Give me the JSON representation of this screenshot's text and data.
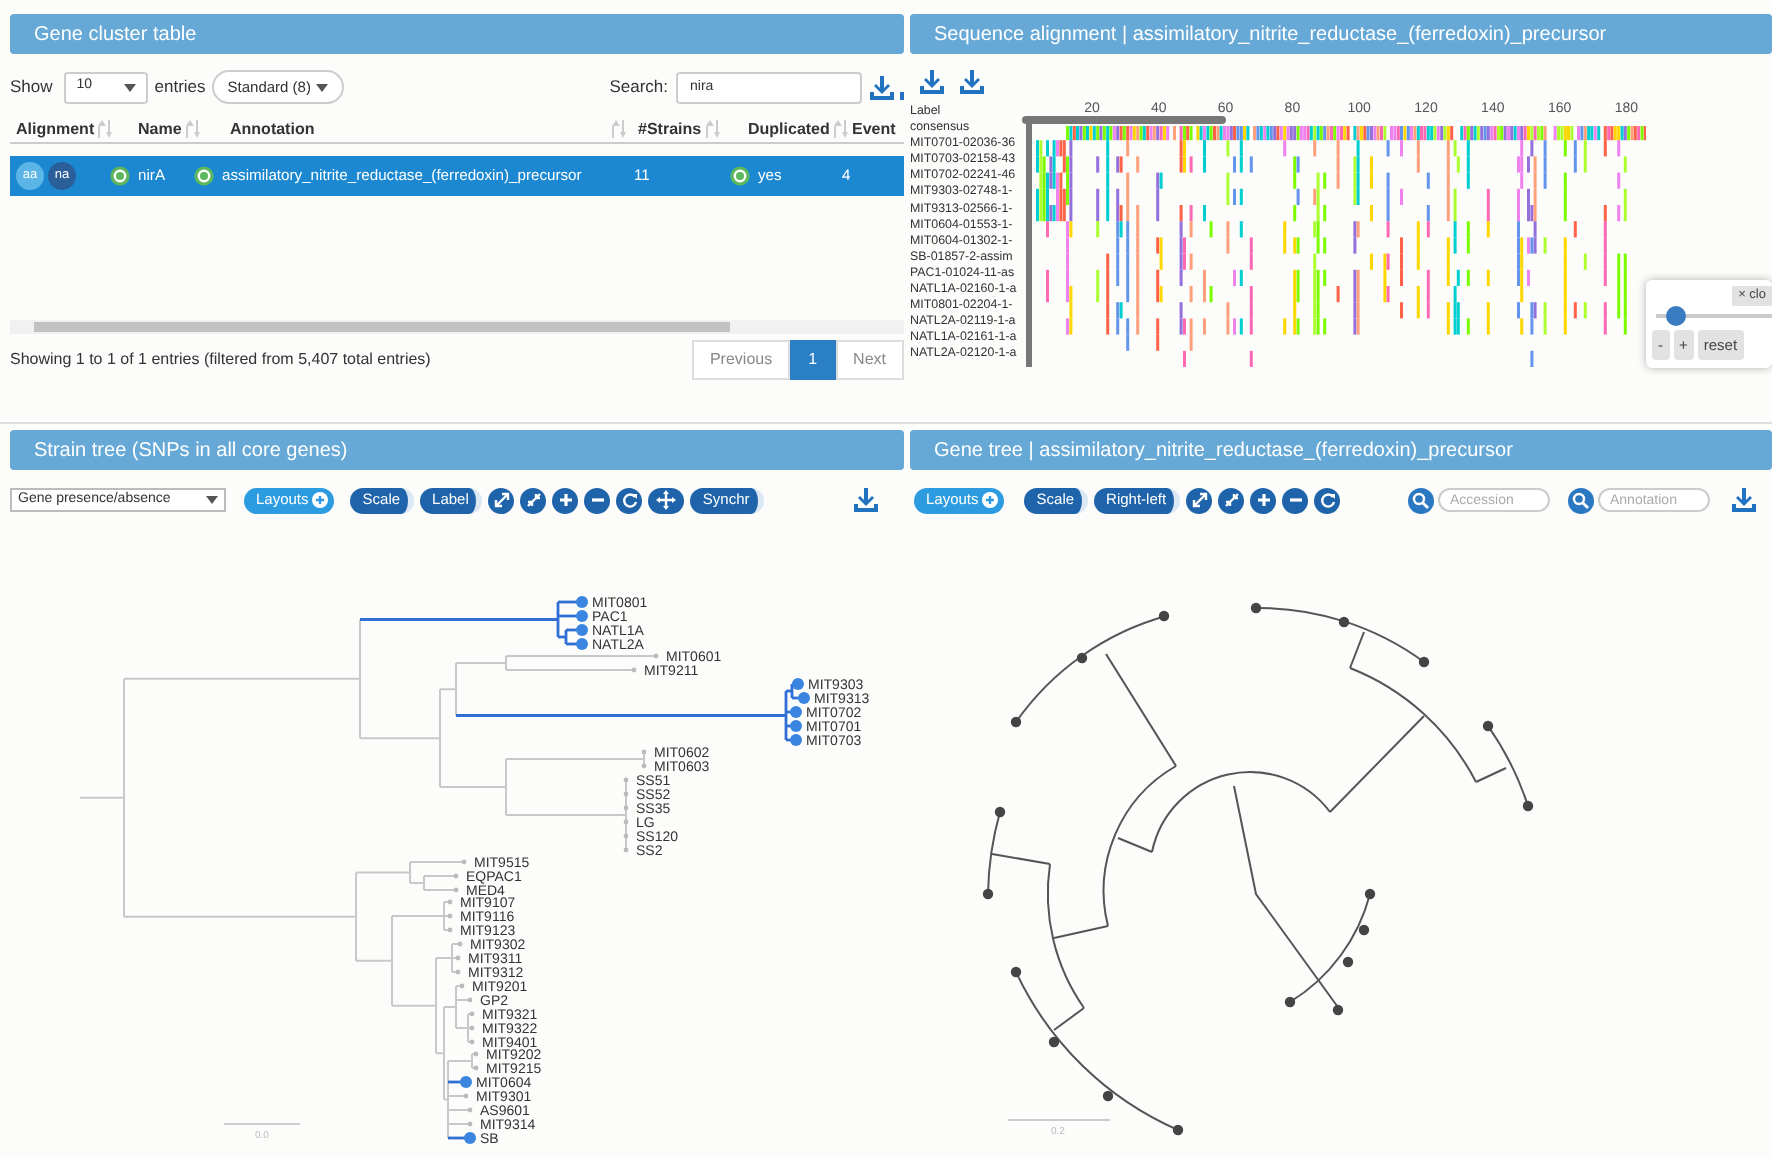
{
  "gene_cluster_table": {
    "title": "Gene cluster table",
    "show_label": "Show",
    "page_size": "10",
    "entries_label": "entries",
    "column_set": "Standard (8)",
    "search_label": "Search:",
    "search_value": "nira",
    "columns": [
      "Alignment",
      "Name",
      "Annotation",
      "#Strains",
      "Duplicated",
      "Event"
    ],
    "rows": [
      {
        "selected": true,
        "alignment_buttons": [
          "aa",
          "na"
        ],
        "name": "nirA",
        "annotation": "assimilatory_nitrite_reductase_(ferredoxin)_precursor",
        "strains": "11",
        "duplicated": "yes",
        "events": "4"
      }
    ],
    "info": "Showing 1 to 1 of 1 entries (filtered from 5,407 total entries)",
    "pagination": [
      {
        "label": "Previous",
        "selected": false
      },
      {
        "label": "1",
        "selected": true
      },
      {
        "label": "Next",
        "selected": false
      }
    ]
  },
  "sequence_alignment": {
    "title": "Sequence alignment | assimilatory_nitrite_reductase_(ferredoxin)_precursor",
    "ruler_ticks": [
      "20",
      "40",
      "60",
      "80",
      "100",
      "120",
      "140",
      "160",
      "180"
    ],
    "label_header": "Label",
    "rows": [
      "consensus",
      "MIT0701-02036-36",
      "MIT0703-02158-43",
      "MIT0702-02241-46",
      "MIT9303-02748-1-",
      "MIT9313-02566-1-",
      "MIT0604-01553-1-",
      "MIT0604-01302-1-",
      "SB-01857-2-assim",
      "PAC1-01024-11-as",
      "NATL1A-02160-1-a",
      "MIT0801-02204-1-",
      "NATL2A-02119-1-a",
      "NATL1A-02161-1-a",
      "NATL2A-02120-1-a"
    ],
    "zoom_controls": {
      "close": "× clo",
      "level": 0.12,
      "buttons": [
        "-",
        "+",
        "reset"
      ]
    }
  },
  "strain_tree": {
    "title": "Strain tree (SNPs in all core genes)",
    "layout_select": "Gene presence/absence",
    "toolbar": [
      {
        "kind": "menu",
        "label": "Layouts"
      },
      {
        "kind": "toggle",
        "label": "Scale"
      },
      {
        "kind": "toggle",
        "label": "Label"
      },
      {
        "kind": "expand"
      },
      {
        "kind": "compress"
      },
      {
        "kind": "zoom-in"
      },
      {
        "kind": "zoom-out"
      },
      {
        "kind": "refresh"
      },
      {
        "kind": "move"
      },
      {
        "kind": "toggle",
        "label": "Synchr"
      }
    ],
    "leaves": [
      {
        "label": "MIT0801",
        "highlighted": true
      },
      {
        "label": "PAC1",
        "highlighted": true
      },
      {
        "label": "NATL1A",
        "highlighted": true
      },
      {
        "label": "NATL2A",
        "highlighted": true
      },
      {
        "label": "MIT0601",
        "highlighted": false
      },
      {
        "label": "MIT9211",
        "highlighted": false
      },
      {
        "label": "MIT9303",
        "highlighted": true
      },
      {
        "label": "MIT9313",
        "highlighted": true
      },
      {
        "label": "MIT0702",
        "highlighted": true
      },
      {
        "label": "MIT0701",
        "highlighted": true
      },
      {
        "label": "MIT0703",
        "highlighted": true
      },
      {
        "label": "MIT0602",
        "highlighted": false
      },
      {
        "label": "MIT0603",
        "highlighted": false
      },
      {
        "label": "SS51",
        "highlighted": false
      },
      {
        "label": "SS52",
        "highlighted": false
      },
      {
        "label": "SS35",
        "highlighted": false
      },
      {
        "label": "LG",
        "highlighted": false
      },
      {
        "label": "SS120",
        "highlighted": false
      },
      {
        "label": "SS2",
        "highlighted": false
      },
      {
        "label": "MIT9515",
        "highlighted": false
      },
      {
        "label": "EQPAC1",
        "highlighted": false
      },
      {
        "label": "MED4",
        "highlighted": false
      },
      {
        "label": "MIT9107",
        "highlighted": false
      },
      {
        "label": "MIT9116",
        "highlighted": false
      },
      {
        "label": "MIT9123",
        "highlighted": false
      },
      {
        "label": "MIT9302",
        "highlighted": false
      },
      {
        "label": "MIT9311",
        "highlighted": false
      },
      {
        "label": "MIT9312",
        "highlighted": false
      },
      {
        "label": "MIT9201",
        "highlighted": false
      },
      {
        "label": "GP2",
        "highlighted": false
      },
      {
        "label": "MIT9321",
        "highlighted": false
      },
      {
        "label": "MIT9322",
        "highlighted": false
      },
      {
        "label": "MIT9401",
        "highlighted": false
      },
      {
        "label": "MIT9202",
        "highlighted": false
      },
      {
        "label": "MIT9215",
        "highlighted": false
      },
      {
        "label": "MIT0604",
        "highlighted": true
      },
      {
        "label": "MIT9301",
        "highlighted": false
      },
      {
        "label": "AS9601",
        "highlighted": false
      },
      {
        "label": "MIT9314",
        "highlighted": false
      },
      {
        "label": "SB",
        "highlighted": true
      }
    ],
    "scale_label": "0.0"
  },
  "gene_tree": {
    "title": "Gene tree | assimilatory_nitrite_reductase_(ferredoxin)_precursor",
    "toolbar": [
      {
        "kind": "menu",
        "label": "Layouts"
      },
      {
        "kind": "toggle",
        "label": "Scale"
      },
      {
        "kind": "toggle",
        "label": "Right-left"
      },
      {
        "kind": "expand"
      },
      {
        "kind": "compress"
      },
      {
        "kind": "zoom-in"
      },
      {
        "kind": "zoom-out"
      },
      {
        "kind": "refresh"
      }
    ],
    "search_fields": [
      {
        "placeholder": "Accession"
      },
      {
        "placeholder": "Annotation"
      }
    ],
    "scale_label": "0.2"
  }
}
